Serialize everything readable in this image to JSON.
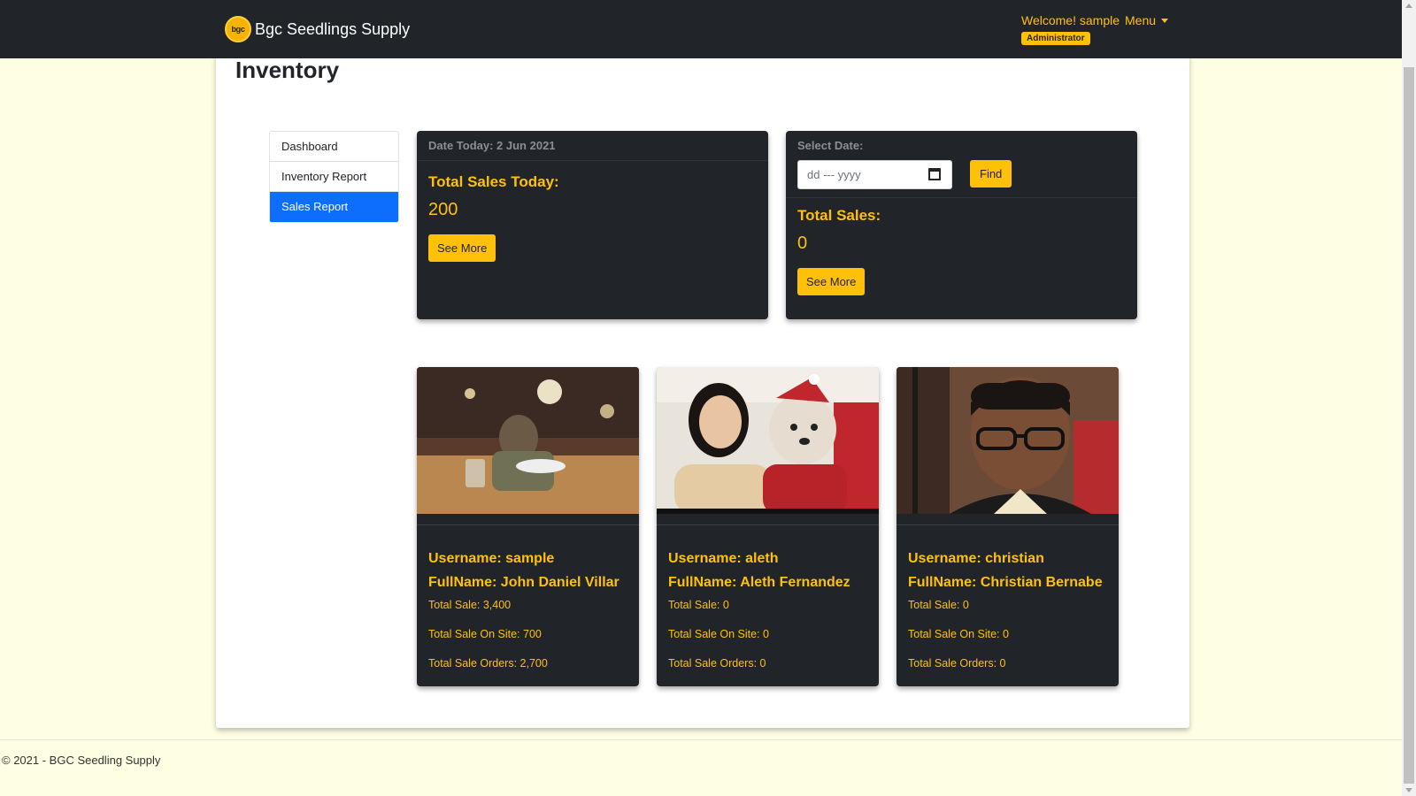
{
  "navbar": {
    "logo_text": "bgc",
    "brand": "Bgc Seedlings Supply",
    "welcome": "Welcome! sample",
    "role": "Administrator",
    "menu_label": "Menu"
  },
  "page": {
    "title": "Inventory"
  },
  "sidebar": {
    "items": [
      {
        "label": "Dashboard",
        "active": false
      },
      {
        "label": "Inventory Report",
        "active": false
      },
      {
        "label": "Sales Report",
        "active": true
      }
    ]
  },
  "today_card": {
    "header": "Date Today: 2 Jun 2021",
    "title": "Total Sales Today:",
    "value": "200",
    "button": "See More"
  },
  "date_card": {
    "header": "Select Date:",
    "date_placeholder": "dd --- yyyy",
    "find_button": "Find",
    "title": "Total Sales:",
    "value": "0",
    "button": "See More"
  },
  "users": [
    {
      "username": "Username: sample",
      "fullname": "FullName: John Daniel Villar",
      "total_sale": "Total Sale: 3,400",
      "total_on_site": "Total Sale On Site: 700",
      "total_orders": "Total Sale Orders: 2,700",
      "photo_icon": "user-photo-restaurant"
    },
    {
      "username": "Username: aleth",
      "fullname": "FullName: Aleth Fernandez",
      "total_sale": "Total Sale: 0",
      "total_on_site": "Total Sale On Site: 0",
      "total_orders": "Total Sale Orders: 0",
      "photo_icon": "user-photo-with-dog"
    },
    {
      "username": "Username: christian",
      "fullname": "FullName: Christian Bernabe",
      "total_sale": "Total Sale: 0",
      "total_on_site": "Total Sale On Site: 0",
      "total_orders": "Total Sale Orders: 0",
      "photo_icon": "user-photo-portrait"
    }
  ],
  "footer": {
    "text": "© 2021 - BGC Seedling Supply"
  },
  "colors": {
    "accent": "#ffc107",
    "dark": "#212529",
    "active": "#0d6efd",
    "background": "#fefee3"
  }
}
